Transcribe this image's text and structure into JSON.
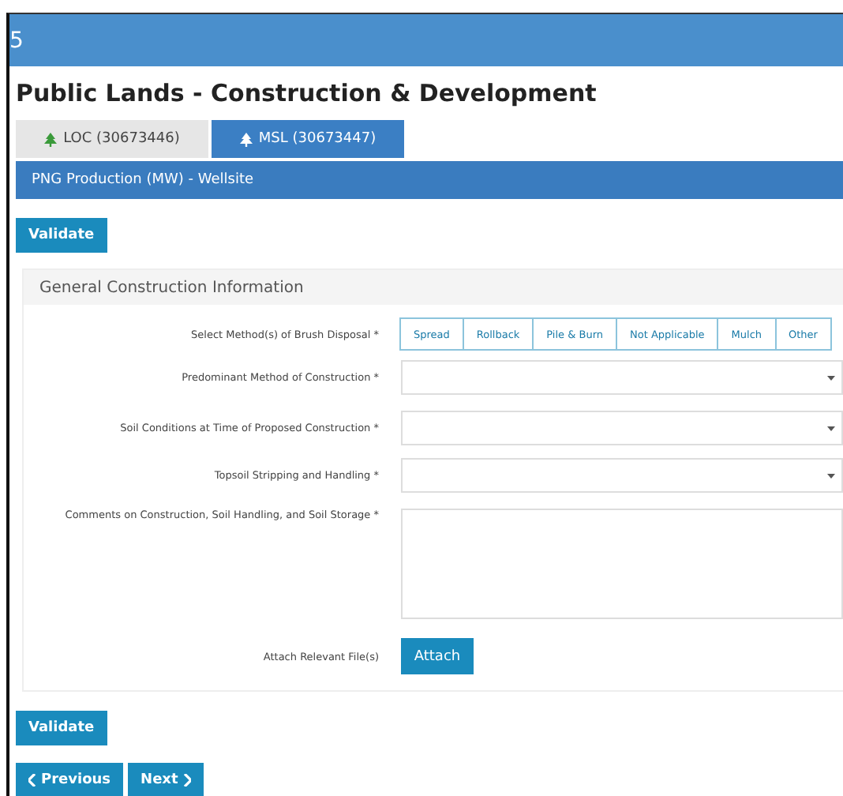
{
  "header": {
    "title": "5"
  },
  "page_title": "Public Lands - Construction & Development",
  "tabs": [
    {
      "label": "LOC (30673446)",
      "selected": false
    },
    {
      "label": "MSL (30673447)",
      "selected": true
    }
  ],
  "section_bar": "PNG Production (MW) - Wellsite",
  "validate_top": "Validate",
  "panel": {
    "title": "General Construction Information",
    "fields": [
      {
        "kind": "toggles",
        "label": "Select Method(s) of Brush Disposal *",
        "options": [
          {
            "label": "Spread",
            "selected": false
          },
          {
            "label": "Rollback",
            "selected": false
          },
          {
            "label": "Pile & Burn",
            "selected": false
          },
          {
            "label": "Not Applicable",
            "selected": false
          },
          {
            "label": "Mulch",
            "selected": false
          },
          {
            "label": "Other",
            "selected": false
          }
        ]
      },
      {
        "kind": "select",
        "label": "Predominant Method of Construction *"
      },
      {
        "kind": "select",
        "label": "Soil Conditions at Time of Proposed Construction *"
      },
      {
        "kind": "select",
        "label": "Topsoil Stripping and Handling *"
      },
      {
        "kind": "textarea",
        "label": "Comments on Construction, Soil Handling, and Soil Storage *"
      },
      {
        "kind": "attach",
        "label": "Attach Relevant File(s)",
        "button": "Attach"
      }
    ]
  },
  "validate_bottom": "Validate",
  "nav": {
    "previous": "Previous",
    "next": "Next"
  }
}
